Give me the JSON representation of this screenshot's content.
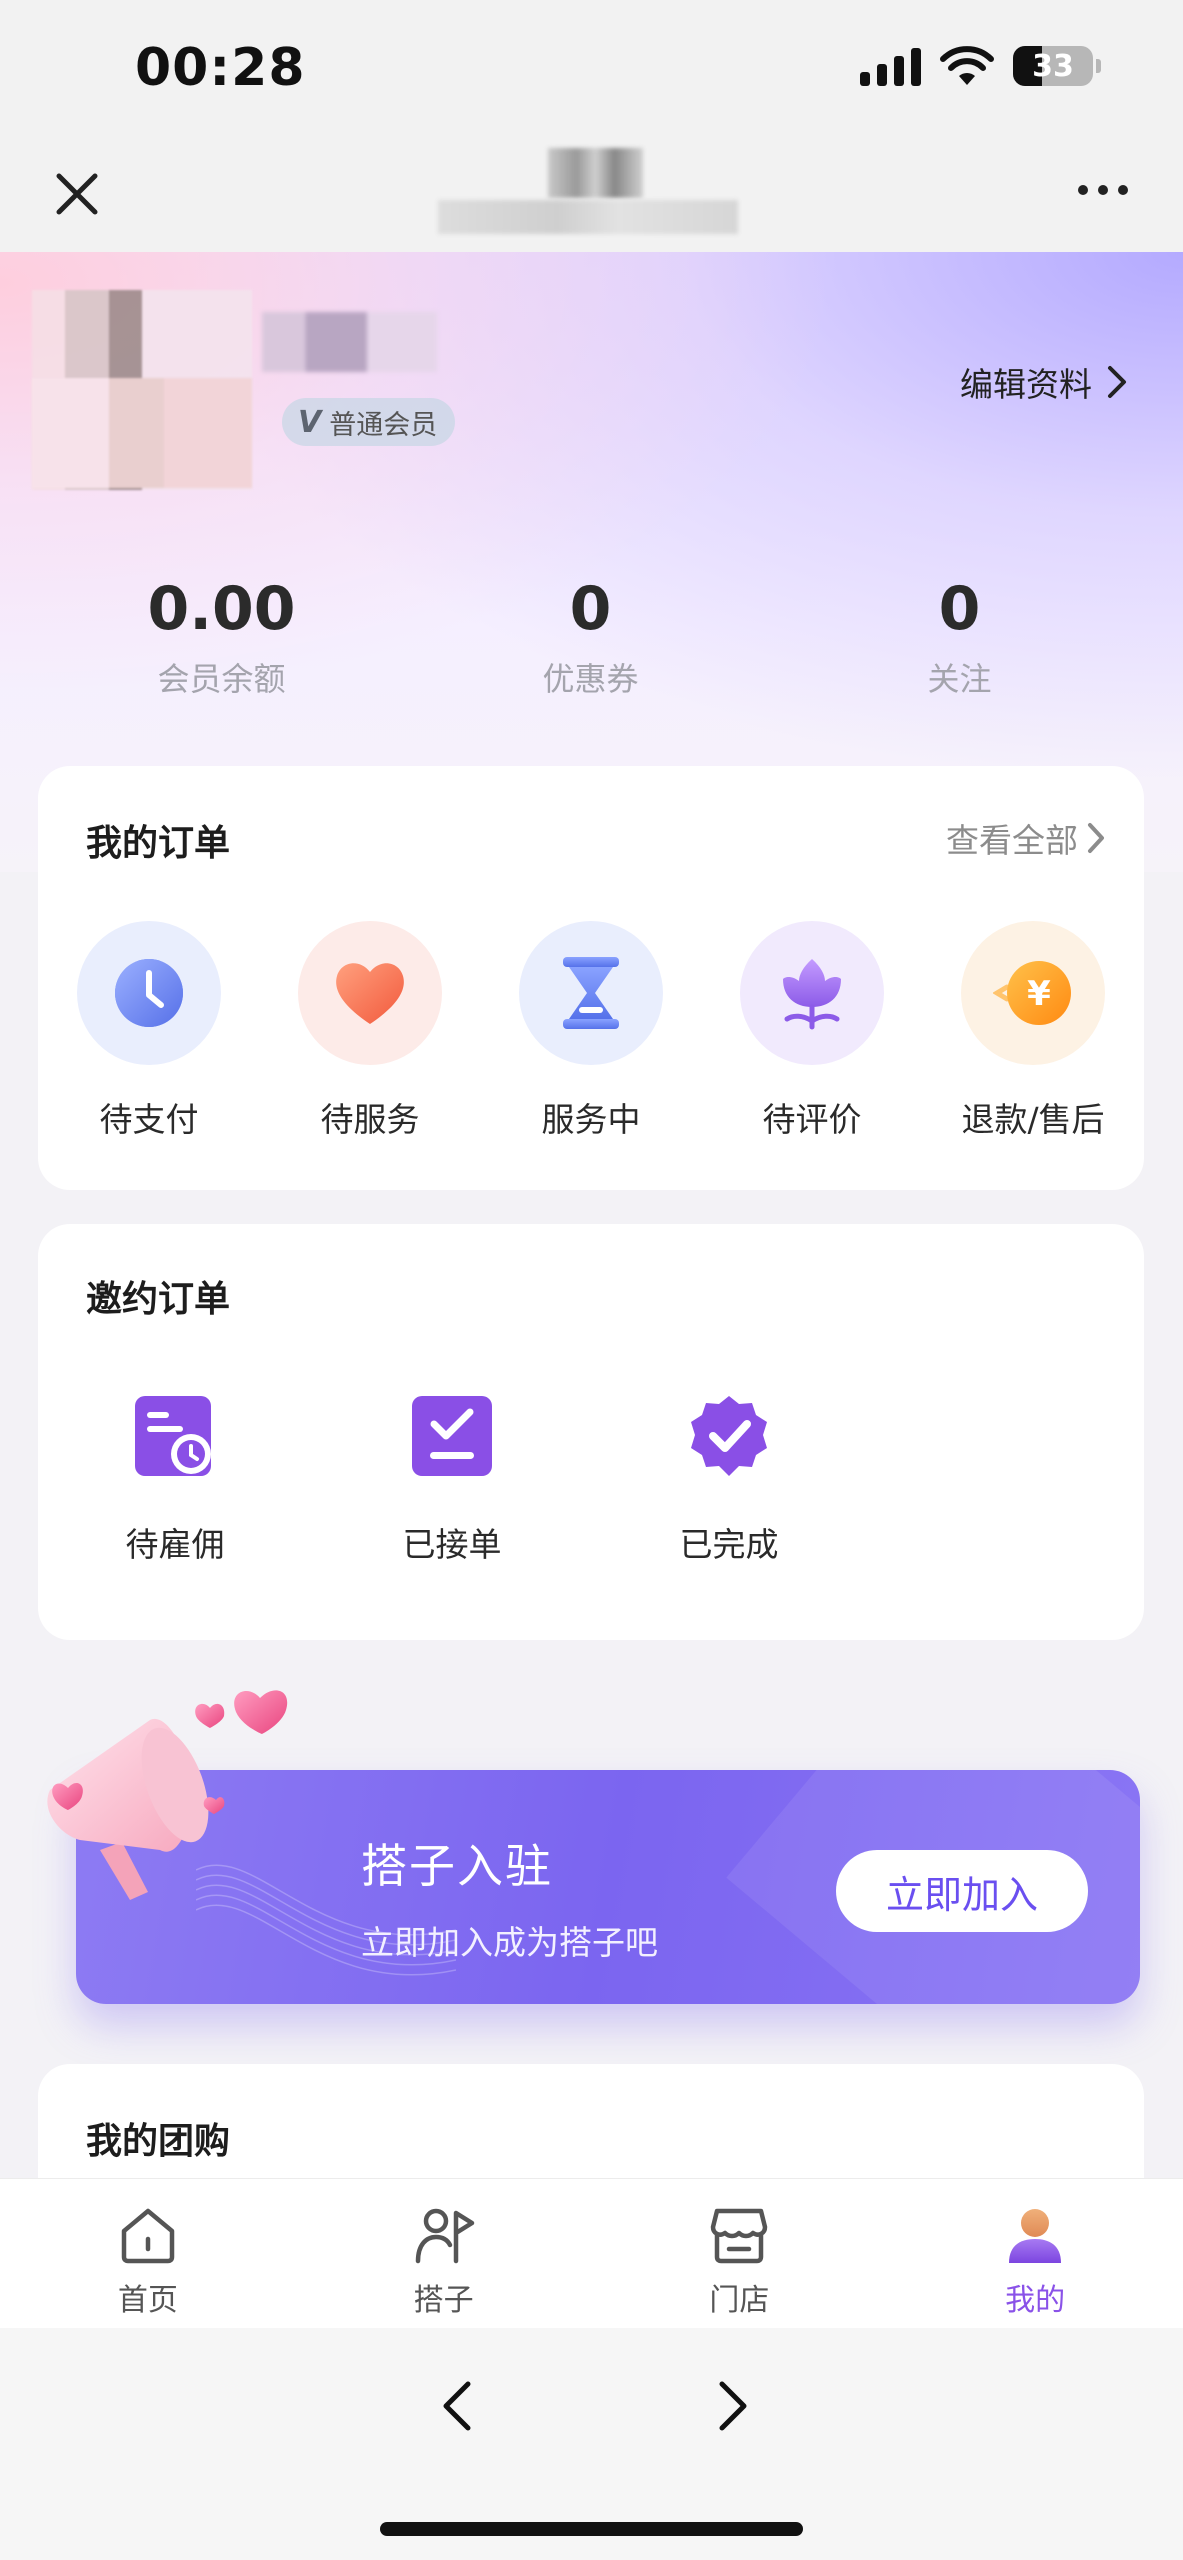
{
  "status_bar": {
    "time": "00:28",
    "battery": "33"
  },
  "profile": {
    "member_badge_mark": "V",
    "member_level": "普通会员",
    "edit_label": "编辑资料"
  },
  "stats": [
    {
      "value": "0.00",
      "label": "会员余额"
    },
    {
      "value": "0",
      "label": "优惠券"
    },
    {
      "value": "0",
      "label": "关注"
    }
  ],
  "my_orders": {
    "title": "我的订单",
    "view_all": "查看全部",
    "items": [
      {
        "label": "待支付",
        "icon": "clock-icon"
      },
      {
        "label": "待服务",
        "icon": "heart-icon"
      },
      {
        "label": "服务中",
        "icon": "hourglass-icon"
      },
      {
        "label": "待评价",
        "icon": "flower-icon"
      },
      {
        "label": "退款/售后",
        "icon": "yen-refund-icon"
      }
    ]
  },
  "invite_orders": {
    "title": "邀约订单",
    "items": [
      {
        "label": "待雇佣",
        "icon": "pending-hire-icon"
      },
      {
        "label": "已接单",
        "icon": "accepted-check-icon"
      },
      {
        "label": "已完成",
        "icon": "completed-badge-icon"
      }
    ]
  },
  "banner": {
    "title": "搭子入驻",
    "subtitle": "立即加入成为搭子吧",
    "button": "立即加入"
  },
  "group_buy": {
    "title": "我的团购"
  },
  "tabbar": {
    "items": [
      {
        "label": "首页",
        "icon": "home-icon"
      },
      {
        "label": "搭子",
        "icon": "partner-flag-icon"
      },
      {
        "label": "门店",
        "icon": "store-icon"
      },
      {
        "label": "我的",
        "icon": "user-avatar-icon"
      }
    ],
    "active_index": 3
  },
  "colors": {
    "accent": "#8a52e8",
    "banner": "#7b65f0"
  }
}
